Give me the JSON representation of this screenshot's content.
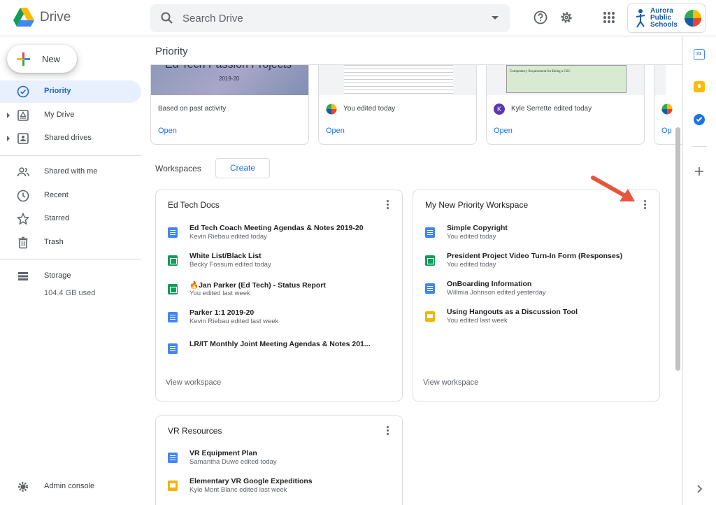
{
  "header": {
    "app_name": "Drive",
    "search_placeholder": "Search Drive",
    "org": {
      "line1": "Aurora",
      "line2": "Public",
      "line3": "Schools"
    }
  },
  "sidebar": {
    "new_label": "New",
    "items": [
      {
        "label": "Priority",
        "icon": "priority-icon",
        "active": true
      },
      {
        "label": "My Drive",
        "icon": "my-drive-icon"
      },
      {
        "label": "Shared drives",
        "icon": "shared-drives-icon"
      },
      {
        "label": "Shared with me",
        "icon": "shared-with-me-icon"
      },
      {
        "label": "Recent",
        "icon": "clock-icon"
      },
      {
        "label": "Starred",
        "icon": "star-icon"
      },
      {
        "label": "Trash",
        "icon": "trash-icon"
      },
      {
        "label": "Storage",
        "icon": "storage-icon"
      }
    ],
    "storage_used": "104.4 GB used",
    "admin_console": "Admin console"
  },
  "main": {
    "title": "Priority",
    "suggested": [
      {
        "thumb_title": "Ed Tech Passion Projects",
        "thumb_subtitle": "2019-20",
        "meta": "Based on past activity",
        "open": "Open"
      },
      {
        "meta": "You edited today",
        "open": "Open"
      },
      {
        "meta": "Kyle Serrette edited today",
        "avatar_letter": "K",
        "open": "Open",
        "thumb_text": "Competency Requirement for Being a CSC"
      },
      {
        "open": "Op"
      }
    ],
    "workspaces_label": "Workspaces",
    "create_label": "Create",
    "view_workspace": "View workspace",
    "workspaces": [
      {
        "title": "Ed Tech Docs",
        "files": [
          {
            "name": "Ed Tech Coach Meeting Agendas & Notes 2019-20",
            "sub": "Kevin Riebau edited today",
            "type": "doc"
          },
          {
            "name": "White List/Black List",
            "sub": "Becky Fossum edited today",
            "type": "sheet"
          },
          {
            "name": "🔥Jan Parker (Ed Tech) - Status Report",
            "sub": "You edited last week",
            "type": "sheet"
          },
          {
            "name": "Parker 1:1 2019-20",
            "sub": "Kevin Riebau edited last week",
            "type": "doc"
          },
          {
            "name": "LR/IT Monthly Joint Meeting Agendas & Notes 201...",
            "sub": "",
            "type": "doc"
          }
        ]
      },
      {
        "title": "My New Priority Workspace",
        "files": [
          {
            "name": "Simple Copyright",
            "sub": "You edited today",
            "type": "doc"
          },
          {
            "name": "President Project Video Turn-In Form (Responses)",
            "sub": "You edited today",
            "type": "sheet"
          },
          {
            "name": "OnBoarding Information",
            "sub": "Willmia Johnson edited yesterday",
            "type": "doc"
          },
          {
            "name": "Using Hangouts as a Discussion Tool",
            "sub": "You edited last week",
            "type": "slide"
          }
        ]
      },
      {
        "title": "VR Resources",
        "files": [
          {
            "name": "VR Equipment Plan",
            "sub": "Samantha Duwe edited today",
            "type": "doc"
          },
          {
            "name": "Elementary VR Google Expeditions",
            "sub": "Kyle Mont Blanc edited last week",
            "type": "slide"
          }
        ]
      }
    ]
  },
  "colors": {
    "doc": "#4285f4",
    "sheet": "#0f9d58",
    "slide": "#f4b400",
    "accent": "#1a73e8",
    "active_bg": "#e8f0fe",
    "arrow": "#e8553e"
  },
  "rail": {
    "calendar_day": "31"
  }
}
